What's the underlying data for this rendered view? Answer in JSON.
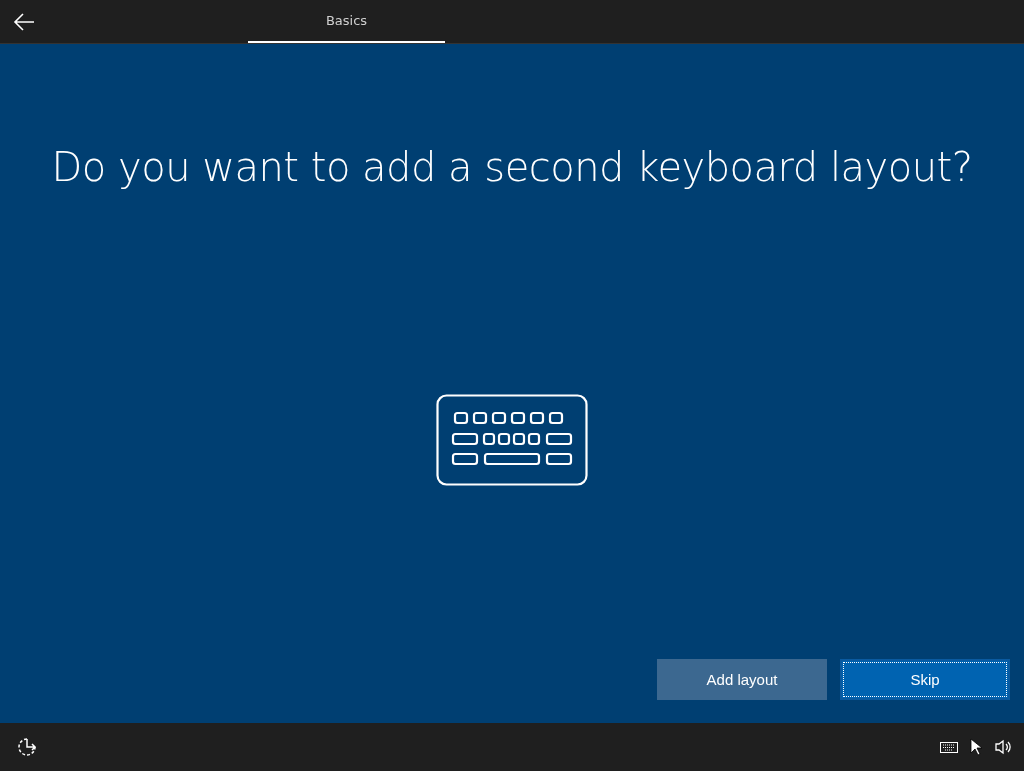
{
  "tabs": [
    {
      "label": "Basics",
      "selected": true
    }
  ],
  "heading": "Do you want to add a second keyboard layout?",
  "buttons": [
    {
      "label": "Add layout",
      "kind": "secondary",
      "focused": false
    },
    {
      "label": "Skip",
      "kind": "primary",
      "focused": true
    }
  ]
}
